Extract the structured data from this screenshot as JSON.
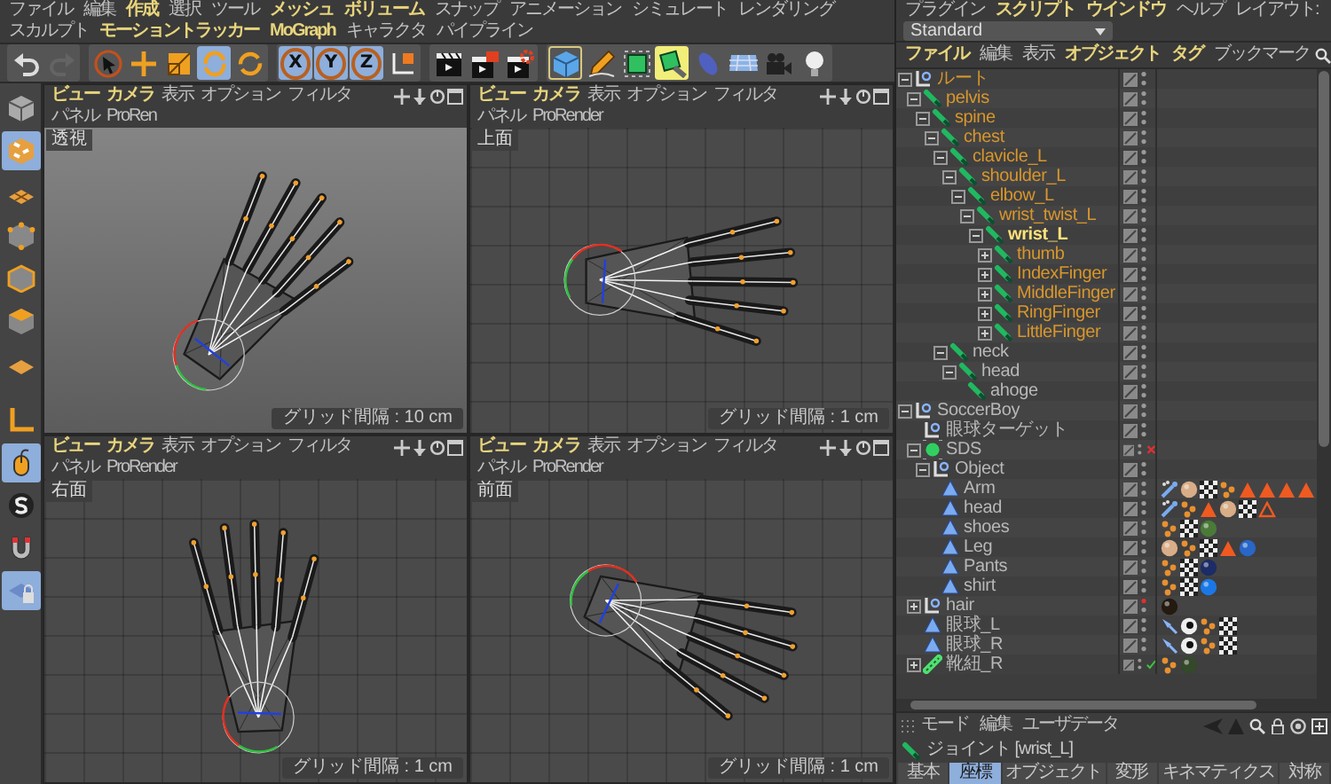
{
  "menubar": {
    "items": [
      {
        "label": "ファイル",
        "accent": false
      },
      {
        "label": "編集",
        "accent": false
      },
      {
        "label": "作成",
        "accent": true
      },
      {
        "label": "選択",
        "accent": false
      },
      {
        "label": "ツール",
        "accent": false
      },
      {
        "label": "メッシュ",
        "accent": true
      },
      {
        "label": "ボリューム",
        "accent": true
      },
      {
        "label": "スナップ",
        "accent": false
      },
      {
        "label": "アニメーション",
        "accent": false
      },
      {
        "label": "シミュレート",
        "accent": false
      },
      {
        "label": "レンダリング",
        "accent": false
      },
      {
        "label": "スカルプト",
        "accent": false
      },
      {
        "label": "モーショントラッカー",
        "accent": true
      },
      {
        "label": "MoGraph",
        "accent": true
      },
      {
        "label": "キャラクタ",
        "accent": false
      },
      {
        "label": "パイプライン",
        "accent": false
      }
    ]
  },
  "toolbar": {
    "groups": [
      [
        {
          "kind": "undo",
          "selected": false,
          "disabled": false,
          "highlighted": false,
          "framed": false
        },
        {
          "kind": "redo",
          "selected": false,
          "disabled": true,
          "highlighted": false,
          "framed": false
        }
      ],
      [
        {
          "kind": "select",
          "selected": false,
          "disabled": false,
          "highlighted": false,
          "framed": false
        },
        {
          "kind": "move",
          "selected": false,
          "disabled": false,
          "highlighted": false,
          "framed": false
        },
        {
          "kind": "scale",
          "selected": false,
          "disabled": false,
          "highlighted": false,
          "framed": false
        },
        {
          "kind": "rotate",
          "selected": true,
          "disabled": false,
          "highlighted": false,
          "framed": false
        },
        {
          "kind": "rotate-recent",
          "selected": false,
          "disabled": false,
          "highlighted": false,
          "framed": false
        }
      ],
      [
        {
          "kind": "axis",
          "label": "X",
          "selected": true,
          "disabled": false,
          "highlighted": false,
          "framed": false
        },
        {
          "kind": "axis",
          "label": "Y",
          "selected": true,
          "disabled": false,
          "highlighted": false,
          "framed": false
        },
        {
          "kind": "axis",
          "label": "Z",
          "selected": true,
          "disabled": false,
          "highlighted": false,
          "framed": false
        },
        {
          "kind": "coord",
          "selected": false,
          "disabled": false,
          "highlighted": false,
          "framed": false
        }
      ],
      [
        {
          "kind": "render-view",
          "selected": false,
          "disabled": false,
          "highlighted": false,
          "framed": false
        },
        {
          "kind": "render-picture",
          "selected": false,
          "disabled": false,
          "highlighted": false,
          "framed": false
        },
        {
          "kind": "render-settings",
          "selected": false,
          "disabled": false,
          "highlighted": false,
          "framed": false
        }
      ],
      [
        {
          "kind": "cube",
          "selected": false,
          "disabled": false,
          "highlighted": false,
          "framed": true
        },
        {
          "kind": "pen",
          "selected": false,
          "disabled": false,
          "highlighted": false,
          "framed": false
        },
        {
          "kind": "subdivision",
          "selected": false,
          "disabled": false,
          "highlighted": false,
          "framed": false
        },
        {
          "kind": "deformer",
          "selected": false,
          "disabled": false,
          "highlighted": true,
          "framed": false
        },
        {
          "kind": "environment",
          "selected": false,
          "disabled": false,
          "highlighted": false,
          "framed": false
        },
        {
          "kind": "floor",
          "selected": false,
          "disabled": false,
          "highlighted": false,
          "framed": false
        },
        {
          "kind": "camera",
          "selected": false,
          "disabled": false,
          "highlighted": false,
          "framed": false
        },
        {
          "kind": "light",
          "selected": false,
          "disabled": false,
          "highlighted": false,
          "framed": false
        }
      ]
    ]
  },
  "side_toolbar": {
    "buttons": [
      {
        "kind": "model",
        "selected": false
      },
      {
        "kind": "texture",
        "selected": true
      },
      {
        "kind": "workplane",
        "selected": false
      },
      {
        "kind": "points",
        "selected": false
      },
      {
        "kind": "edges",
        "selected": false
      },
      {
        "kind": "polygons",
        "selected": false
      },
      {
        "kind": "uv",
        "selected": false
      },
      {
        "kind": "axis",
        "selected": false
      },
      {
        "kind": "mouse",
        "selected": true
      },
      {
        "kind": "solo",
        "selected": false
      },
      {
        "kind": "magnet",
        "selected": false
      },
      {
        "kind": "lock-grid",
        "selected": true
      }
    ]
  },
  "viewports": [
    {
      "kind": "perspective",
      "label": "透視",
      "grid": "グリッド間隔 : 10 cm",
      "menu": [
        {
          "label": "ビュー",
          "accent": true
        },
        {
          "label": "カメラ",
          "accent": true
        },
        {
          "label": "表示",
          "accent": false
        },
        {
          "label": "オプション",
          "accent": false
        },
        {
          "label": "フィルタ",
          "accent": false
        },
        {
          "label": "パネル",
          "accent": false
        },
        {
          "label": "ProRen",
          "accent": false
        }
      ]
    },
    {
      "kind": "top",
      "label": "上面",
      "grid": "グリッド間隔 : 1 cm",
      "menu": [
        {
          "label": "ビュー",
          "accent": true
        },
        {
          "label": "カメラ",
          "accent": true
        },
        {
          "label": "表示",
          "accent": false
        },
        {
          "label": "オプション",
          "accent": false
        },
        {
          "label": "フィルタ",
          "accent": false
        },
        {
          "label": "パネル",
          "accent": false
        },
        {
          "label": "ProRender",
          "accent": false
        }
      ]
    },
    {
      "kind": "right",
      "label": "右面",
      "grid": "グリッド間隔 : 1 cm",
      "menu": [
        {
          "label": "ビュー",
          "accent": true
        },
        {
          "label": "カメラ",
          "accent": true
        },
        {
          "label": "表示",
          "accent": false
        },
        {
          "label": "オプション",
          "accent": false
        },
        {
          "label": "フィルタ",
          "accent": false
        },
        {
          "label": "パネル",
          "accent": false
        },
        {
          "label": "ProRender",
          "accent": false
        }
      ]
    },
    {
      "kind": "front",
      "label": "前面",
      "grid": "グリッド間隔 : 1 cm",
      "menu": [
        {
          "label": "ビュー",
          "accent": true
        },
        {
          "label": "カメラ",
          "accent": true
        },
        {
          "label": "表示",
          "accent": false
        },
        {
          "label": "オプション",
          "accent": false
        },
        {
          "label": "フィルタ",
          "accent": false
        },
        {
          "label": "パネル",
          "accent": false
        },
        {
          "label": "ProRender",
          "accent": false
        }
      ]
    }
  ],
  "right_menubar": {
    "items": [
      {
        "label": "プラグイン",
        "accent": false
      },
      {
        "label": "スクリプト",
        "accent": true
      },
      {
        "label": "ウインドウ",
        "accent": true
      },
      {
        "label": "ヘルプ",
        "accent": false
      }
    ],
    "layout_label": "レイアウト:",
    "layout_value": "Standard"
  },
  "object_manager": {
    "menu": [
      {
        "label": "ファイル",
        "accent": true
      },
      {
        "label": "編集",
        "accent": false
      },
      {
        "label": "表示",
        "accent": false
      },
      {
        "label": "オブジェクト",
        "accent": true
      },
      {
        "label": "タグ",
        "accent": true
      },
      {
        "label": "ブックマーク",
        "accent": false
      }
    ],
    "tree": [
      {
        "name": "ルート",
        "kind": "null",
        "expanded": true,
        "selected": true,
        "focused": false,
        "deactivated": false,
        "checked": false,
        "editor_hidden": false,
        "children": [
          {
            "name": "pelvis",
            "kind": "joint",
            "expanded": true,
            "selected": true,
            "focused": false,
            "deactivated": false,
            "checked": false,
            "editor_hidden": false,
            "children": [
              {
                "name": "spine",
                "kind": "joint",
                "expanded": true,
                "selected": true,
                "focused": false,
                "deactivated": false,
                "checked": false,
                "editor_hidden": false,
                "children": [
                  {
                    "name": "chest",
                    "kind": "joint",
                    "expanded": true,
                    "selected": true,
                    "focused": false,
                    "deactivated": false,
                    "checked": false,
                    "editor_hidden": false,
                    "children": [
                      {
                        "name": "clavicle_L",
                        "kind": "joint",
                        "expanded": true,
                        "selected": true,
                        "focused": false,
                        "deactivated": false,
                        "checked": false,
                        "editor_hidden": false,
                        "children": [
                          {
                            "name": "shoulder_L",
                            "kind": "joint",
                            "expanded": true,
                            "selected": true,
                            "focused": false,
                            "deactivated": false,
                            "checked": false,
                            "editor_hidden": false,
                            "children": [
                              {
                                "name": "elbow_L",
                                "kind": "joint",
                                "expanded": true,
                                "selected": true,
                                "focused": false,
                                "deactivated": false,
                                "checked": false,
                                "editor_hidden": false,
                                "children": [
                                  {
                                    "name": "wrist_twist_L",
                                    "kind": "joint",
                                    "expanded": true,
                                    "selected": true,
                                    "focused": false,
                                    "deactivated": false,
                                    "checked": false,
                                    "editor_hidden": false,
                                    "children": [
                                      {
                                        "name": "wrist_L",
                                        "kind": "joint",
                                        "expanded": true,
                                        "selected": true,
                                        "focused": true,
                                        "deactivated": false,
                                        "checked": false,
                                        "editor_hidden": false,
                                        "children": [
                                          {
                                            "name": "thumb",
                                            "kind": "joint",
                                            "expanded": false,
                                            "selected": true,
                                            "focused": false,
                                            "deactivated": false,
                                            "checked": false,
                                            "editor_hidden": false
                                          },
                                          {
                                            "name": "IndexFinger",
                                            "kind": "joint",
                                            "expanded": false,
                                            "selected": true,
                                            "focused": false,
                                            "deactivated": false,
                                            "checked": false,
                                            "editor_hidden": false
                                          },
                                          {
                                            "name": "MiddleFinger",
                                            "kind": "joint",
                                            "expanded": false,
                                            "selected": true,
                                            "focused": false,
                                            "deactivated": false,
                                            "checked": false,
                                            "editor_hidden": false
                                          },
                                          {
                                            "name": "RingFinger",
                                            "kind": "joint",
                                            "expanded": false,
                                            "selected": true,
                                            "focused": false,
                                            "deactivated": false,
                                            "checked": false,
                                            "editor_hidden": false
                                          },
                                          {
                                            "name": "LittleFinger",
                                            "kind": "joint",
                                            "expanded": false,
                                            "selected": true,
                                            "focused": false,
                                            "deactivated": false,
                                            "checked": false,
                                            "editor_hidden": false
                                          }
                                        ]
                                      }
                                    ]
                                  }
                                ]
                              }
                            ]
                          }
                        ]
                      },
                      {
                        "name": "neck",
                        "kind": "joint",
                        "expanded": true,
                        "selected": false,
                        "focused": false,
                        "deactivated": false,
                        "checked": false,
                        "editor_hidden": false,
                        "children": [
                          {
                            "name": "head",
                            "kind": "joint",
                            "expanded": true,
                            "selected": false,
                            "focused": false,
                            "deactivated": false,
                            "checked": false,
                            "editor_hidden": false,
                            "children": [
                              {
                                "name": "ahoge",
                                "kind": "joint",
                                "selected": false,
                                "focused": false,
                                "deactivated": false,
                                "checked": false,
                                "editor_hidden": false
                              }
                            ]
                          }
                        ]
                      }
                    ]
                  }
                ]
              }
            ]
          }
        ]
      },
      {
        "name": "SoccerBoy",
        "kind": "null",
        "expanded": true,
        "selected": false,
        "focused": false,
        "deactivated": false,
        "checked": false,
        "editor_hidden": false,
        "children": [
          {
            "name": "眼球ターゲット",
            "kind": "null",
            "selected": false,
            "focused": false,
            "deactivated": false,
            "checked": false,
            "editor_hidden": false
          },
          {
            "name": "SDS",
            "kind": "sds",
            "expanded": true,
            "selected": false,
            "focused": false,
            "deactivated": true,
            "checked": false,
            "editor_hidden": false,
            "children": [
              {
                "name": "Object",
                "kind": "null",
                "expanded": true,
                "selected": false,
                "focused": false,
                "deactivated": false,
                "checked": false,
                "editor_hidden": false,
                "children": [
                  {
                    "name": "Arm",
                    "kind": "polygon",
                    "selected": false,
                    "focused": false,
                    "deactivated": false,
                    "checked": false,
                    "editor_hidden": false,
                    "tags": [
                      {
                        "kind": "skin"
                      },
                      {
                        "kind": "material",
                        "color": "#d8ad88"
                      },
                      {
                        "kind": "texture"
                      },
                      {
                        "kind": "weight"
                      },
                      {
                        "kind": "triangle"
                      },
                      {
                        "kind": "triangle"
                      },
                      {
                        "kind": "triangle"
                      },
                      {
                        "kind": "triangle"
                      }
                    ]
                  },
                  {
                    "name": "head",
                    "kind": "polygon",
                    "selected": false,
                    "focused": false,
                    "deactivated": false,
                    "checked": false,
                    "editor_hidden": false,
                    "tags": [
                      {
                        "kind": "skin"
                      },
                      {
                        "kind": "weight"
                      },
                      {
                        "kind": "triangle"
                      },
                      {
                        "kind": "material",
                        "color": "#d8ad88"
                      },
                      {
                        "kind": "texture"
                      },
                      {
                        "kind": "triangle-outline"
                      }
                    ]
                  },
                  {
                    "name": "shoes",
                    "kind": "polygon",
                    "selected": false,
                    "focused": false,
                    "deactivated": false,
                    "checked": false,
                    "editor_hidden": false,
                    "tags": [
                      {
                        "kind": "weight"
                      },
                      {
                        "kind": "texture"
                      },
                      {
                        "kind": "material",
                        "color": "#4a7a38"
                      }
                    ]
                  },
                  {
                    "name": "Leg",
                    "kind": "polygon",
                    "selected": false,
                    "focused": false,
                    "deactivated": false,
                    "checked": false,
                    "editor_hidden": false,
                    "tags": [
                      {
                        "kind": "material",
                        "color": "#d8ad88"
                      },
                      {
                        "kind": "weight"
                      },
                      {
                        "kind": "texture"
                      },
                      {
                        "kind": "triangle"
                      },
                      {
                        "kind": "material",
                        "color": "#2866c8"
                      }
                    ]
                  },
                  {
                    "name": "Pants",
                    "kind": "polygon",
                    "selected": false,
                    "focused": false,
                    "deactivated": false,
                    "checked": false,
                    "editor_hidden": false,
                    "tags": [
                      {
                        "kind": "weight"
                      },
                      {
                        "kind": "texture"
                      },
                      {
                        "kind": "material",
                        "color": "#1c2c66"
                      }
                    ]
                  },
                  {
                    "name": "shirt",
                    "kind": "polygon",
                    "selected": false,
                    "focused": false,
                    "deactivated": false,
                    "checked": false,
                    "editor_hidden": false,
                    "tags": [
                      {
                        "kind": "weight"
                      },
                      {
                        "kind": "texture"
                      },
                      {
                        "kind": "material",
                        "color": "#1a78e6"
                      }
                    ]
                  }
                ]
              }
            ]
          },
          {
            "name": "hair",
            "kind": "null",
            "expanded": false,
            "selected": false,
            "focused": false,
            "deactivated": false,
            "checked": false,
            "editor_hidden": true,
            "tags": [
              {
                "kind": "material",
                "color": "#241a10"
              }
            ]
          },
          {
            "name": "眼球_L",
            "kind": "polygon",
            "selected": false,
            "focused": false,
            "deactivated": false,
            "checked": false,
            "editor_hidden": false,
            "tags": [
              {
                "kind": "pin"
              },
              {
                "kind": "eye"
              },
              {
                "kind": "weight"
              },
              {
                "kind": "texture"
              }
            ]
          },
          {
            "name": "眼球_R",
            "kind": "polygon",
            "selected": false,
            "focused": false,
            "deactivated": false,
            "checked": false,
            "editor_hidden": false,
            "tags": [
              {
                "kind": "pin"
              },
              {
                "kind": "eye"
              },
              {
                "kind": "weight"
              },
              {
                "kind": "texture"
              }
            ]
          },
          {
            "name": "靴紐_R",
            "kind": "spline",
            "expanded": false,
            "selected": false,
            "focused": false,
            "deactivated": false,
            "checked": true,
            "editor_hidden": false,
            "tags": [
              {
                "kind": "weight"
              },
              {
                "kind": "material",
                "color": "#34482a"
              }
            ]
          }
        ]
      }
    ]
  },
  "attributes": {
    "menu": [
      {
        "label": "モード",
        "accent": false
      },
      {
        "label": "編集",
        "accent": false
      },
      {
        "label": "ユーザデータ",
        "accent": false
      }
    ],
    "title": "ジョイント [wrist_L]",
    "tabs": [
      {
        "label": "基本",
        "selected": false
      },
      {
        "label": "座標",
        "selected": true
      },
      {
        "label": "オブジェクト",
        "selected": false
      },
      {
        "label": "変形",
        "selected": false
      },
      {
        "label": "キネマティクス",
        "selected": false
      },
      {
        "label": "対称",
        "selected": false
      }
    ]
  }
}
